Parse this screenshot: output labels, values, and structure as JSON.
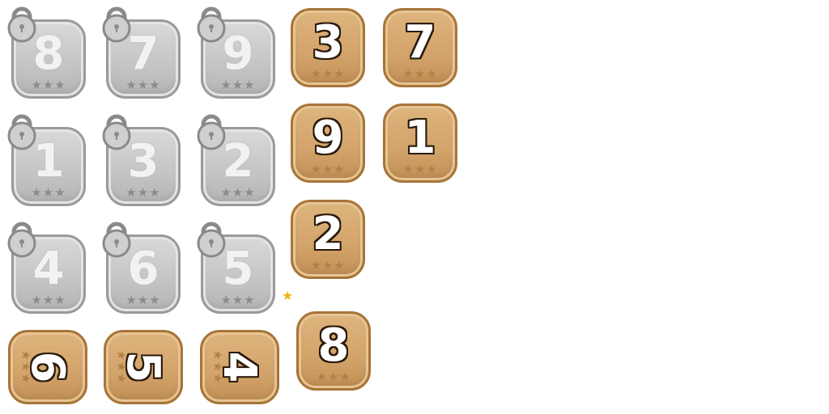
{
  "icons": {
    "lock": "padlock-icon",
    "star": "star-icon",
    "sparkle": "sparkle-icon"
  },
  "colors": {
    "locked_tile": "#c8c8c8",
    "open_tile": "#d2a36a",
    "outline": "#2a1a0a",
    "sparkle": "#f2b21a"
  },
  "star_glyphs": "★★★",
  "sparkle_glyph": "★",
  "locked_levels": [
    {
      "number": "8"
    },
    {
      "number": "7"
    },
    {
      "number": "9"
    },
    {
      "number": "1"
    },
    {
      "number": "3"
    },
    {
      "number": "2"
    },
    {
      "number": "4"
    },
    {
      "number": "6"
    },
    {
      "number": "5"
    }
  ],
  "rotated_levels": [
    {
      "number": "6"
    },
    {
      "number": "5"
    },
    {
      "number": "4"
    }
  ],
  "open_levels": [
    {
      "number": "3"
    },
    {
      "number": "7"
    },
    {
      "number": "9"
    },
    {
      "number": "1"
    },
    {
      "number": "2"
    },
    {
      "number": "8"
    }
  ]
}
